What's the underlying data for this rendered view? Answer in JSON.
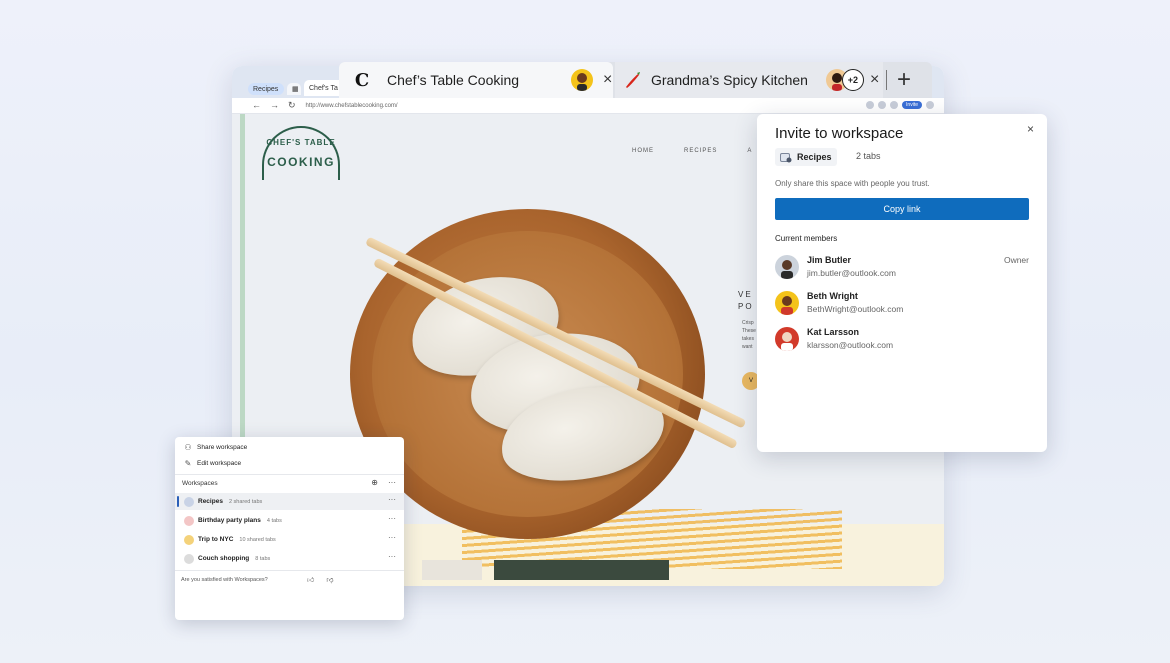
{
  "colors": {
    "accent_blue": "#0f6cbd",
    "background": "#eef1fa"
  },
  "browser": {
    "mini_tabs": {
      "group_label": "Recipes",
      "active_label": "Chef's Ta"
    },
    "address": {
      "url": "http://www.chefstablecooking.com/",
      "invite_label": "Invite"
    },
    "site": {
      "logo_line1": "CHEF'S TABLE",
      "logo_line2": "COOKING",
      "nav": [
        "HOME",
        "RECIPES",
        "A"
      ],
      "side_heading_1": "VE",
      "side_heading_2": "PO",
      "side_copy": [
        "Crisp",
        "These",
        "takes",
        "want"
      ],
      "side_button": "V"
    }
  },
  "tabs": {
    "active": {
      "title": "Chef’s Table Cooking",
      "favicon": "C"
    },
    "inactive": {
      "title": "Grandma’s Spicy Kitchen",
      "badge": "+2"
    },
    "close_glyph": "×",
    "new_tab_glyph": "+"
  },
  "invite": {
    "title": "Invite to workspace",
    "close_glyph": "×",
    "workspace_name": "Recipes",
    "tab_count": "2 tabs",
    "trust_note": "Only share this space with people you trust.",
    "copy_link": "Copy link",
    "members_title": "Current members",
    "members": [
      {
        "name": "Jim Butler",
        "email": "jim.butler@outlook.com",
        "role": "Owner",
        "avatar_color": "#ccd3dc"
      },
      {
        "name": "Beth Wright",
        "email": "BethWright@outlook.com",
        "role": "",
        "avatar_color": "#f4c31a"
      },
      {
        "name": "Kat Larsson",
        "email": "klarsson@outlook.com",
        "role": "",
        "avatar_color": "#d23a2a"
      }
    ]
  },
  "workspaces_panel": {
    "share": "Share workspace",
    "edit": "Edit workspace",
    "header": "Workspaces",
    "add_glyph": "⊕",
    "more_glyph": "···",
    "items": [
      {
        "name": "Recipes",
        "meta": "2 shared tabs",
        "icon_color": "#c9d3e6"
      },
      {
        "name": "Birthday party plans",
        "meta": "4 tabs",
        "icon_color": "#f3c6c6"
      },
      {
        "name": "Trip to NYC",
        "meta": "10 shared tabs",
        "icon_color": "#f4d27a"
      },
      {
        "name": "Couch shopping",
        "meta": "8 tabs",
        "icon_color": "#dcdcdc"
      }
    ],
    "feedback": "Are you satisfied with Workspaces?"
  }
}
